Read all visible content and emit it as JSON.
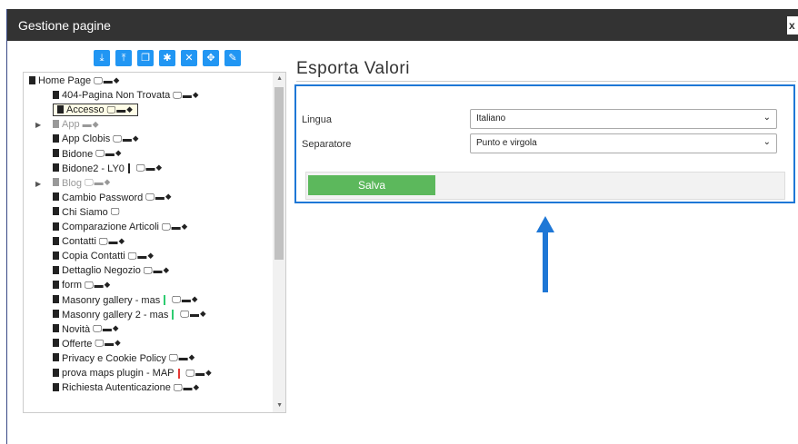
{
  "window": {
    "title": "Gestione pagine",
    "close": "x"
  },
  "toolbar": [
    {
      "name": "download-icon",
      "glyph": "⤓"
    },
    {
      "name": "upload-icon",
      "glyph": "⤒"
    },
    {
      "name": "copy-icon",
      "glyph": "❐"
    },
    {
      "name": "settings-icon",
      "glyph": "✱"
    },
    {
      "name": "delete-icon",
      "glyph": "✕"
    },
    {
      "name": "move-icon",
      "glyph": "✥"
    },
    {
      "name": "edit-icon",
      "glyph": "✎"
    }
  ],
  "tree": [
    {
      "label": "Home Page",
      "level": 0,
      "devices": "🖵▬⬥"
    },
    {
      "label": "404-Pagina Non Trovata",
      "level": 1,
      "devices": "🖵▬⬥"
    },
    {
      "label": "Accesso",
      "level": 1,
      "devices": "🖵▬⬥",
      "selected": true
    },
    {
      "label": "App",
      "level": 1,
      "devices": "▬⬥",
      "gray": true,
      "expandable": true
    },
    {
      "label": "App Clobis",
      "level": 1,
      "devices": "🖵▬⬥"
    },
    {
      "label": "Bidone",
      "level": 1,
      "devices": "🖵▬⬥"
    },
    {
      "label": "Bidone2 - LY0",
      "level": 1,
      "devices": "🖵▬⬥",
      "bar": "#222"
    },
    {
      "label": "Blog",
      "level": 1,
      "devices": "🖵▬⬥",
      "gray": true,
      "expandable": true
    },
    {
      "label": "Cambio Password",
      "level": 1,
      "devices": "🖵▬⬥"
    },
    {
      "label": "Chi Siamo",
      "level": 1,
      "devices": "🖵"
    },
    {
      "label": "Comparazione Articoli",
      "level": 1,
      "devices": "🖵▬⬥"
    },
    {
      "label": "Contatti",
      "level": 1,
      "devices": "🖵▬⬥"
    },
    {
      "label": "Copia Contatti",
      "level": 1,
      "devices": "🖵▬⬥"
    },
    {
      "label": "Dettaglio Negozio",
      "level": 1,
      "devices": "🖵▬⬥"
    },
    {
      "label": "form",
      "level": 1,
      "devices": "🖵▬⬥"
    },
    {
      "label": "Masonry gallery - mas",
      "level": 1,
      "devices": "🖵▬⬥",
      "bar": "#2ecc71"
    },
    {
      "label": "Masonry gallery 2 - mas",
      "level": 1,
      "devices": "🖵▬⬥",
      "bar": "#2ecc71"
    },
    {
      "label": "Novità",
      "level": 1,
      "devices": "🖵▬⬥"
    },
    {
      "label": "Offerte",
      "level": 1,
      "devices": "🖵▬⬥"
    },
    {
      "label": "Privacy e Cookie Policy",
      "level": 1,
      "devices": "🖵▬⬥"
    },
    {
      "label": "prova maps plugin - MAP",
      "level": 1,
      "devices": "🖵▬⬥",
      "bar": "#e53935"
    },
    {
      "label": "Richiesta Autenticazione",
      "level": 1,
      "devices": "🖵▬⬥"
    }
  ],
  "main": {
    "heading": "Esporta Valori",
    "fields": [
      {
        "label": "Lingua",
        "value": "Italiano"
      },
      {
        "label": "Separatore",
        "value": "Punto e virgola"
      }
    ],
    "save_label": "Salva"
  },
  "colors": {
    "accent": "#2196f3",
    "panel_border": "#1e77d6",
    "save": "#5cb85c",
    "titlebar": "#333333"
  }
}
